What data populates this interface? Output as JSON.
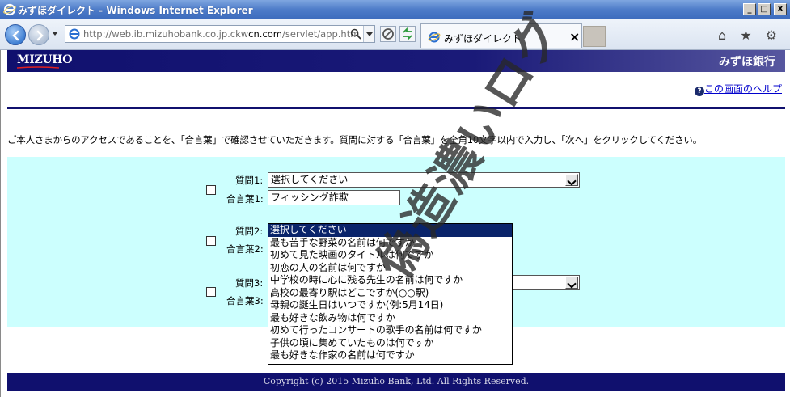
{
  "window": {
    "title": "みずほダイレクト - Windows Internet Explorer",
    "controls": {
      "minimize": "_",
      "maximize": "□",
      "close": "X"
    }
  },
  "toolbar": {
    "url_prefix": "http://web.ib.mizuhobank.co.jp.ckw",
    "url_domain": "cn.com",
    "url_suffix": "/servlet/app.htm",
    "tab_title": "みずほダイレクト",
    "tab_close": "×",
    "right_icons": "⌂ ★ ⚙"
  },
  "header": {
    "logo": "MIZUHO",
    "bank_name": "みずほ銀行",
    "help_icon": "?",
    "help_link": "この画面のヘルプ"
  },
  "instructions": "ご本人さまからのアクセスであることを、「合言葉」で確認させていただきます。質問に対する「合言葉」を全角10文字以内で入力し、「次へ」をクリックしてください。",
  "questions": [
    {
      "question_label": "質問1:",
      "answer_label": "合言葉1:",
      "selected": "選択してください",
      "answer": "フィッシング詐欺"
    },
    {
      "question_label": "質問2:",
      "answer_label": "合言葉2:",
      "selected": "",
      "answer": ""
    },
    {
      "question_label": "質問3:",
      "answer_label": "合言葉3:",
      "selected": "",
      "answer": ""
    }
  ],
  "dropdown_options": [
    "選択してください",
    "最も苦手な野菜の名前は何ですか",
    "初めて見た映画のタイトルは何ですか",
    "初恋の人の名前は何ですか",
    "中学校の時に心に残る先生の名前は何ですか",
    "高校の最寄り駅はどこですか(○○駅)",
    "母親の誕生日はいつですか(例:5月14日)",
    "最も好きな飲み物は何ですか",
    "初めて行ったコンサートの歌手の名前は何ですか",
    "子供の頃に集めていたものは何ですか",
    "最も好きな作家の名前は何ですか"
  ],
  "footer": "Copyright (c) 2015 Mizuho Bank, Ltd. All Rights Reserved.",
  "watermark": "偽造濃いログ",
  "colors": {
    "brand_navy": "#10106e",
    "panel_cyan": "#ccfffe",
    "listbox_highlight": "#0a246a"
  }
}
